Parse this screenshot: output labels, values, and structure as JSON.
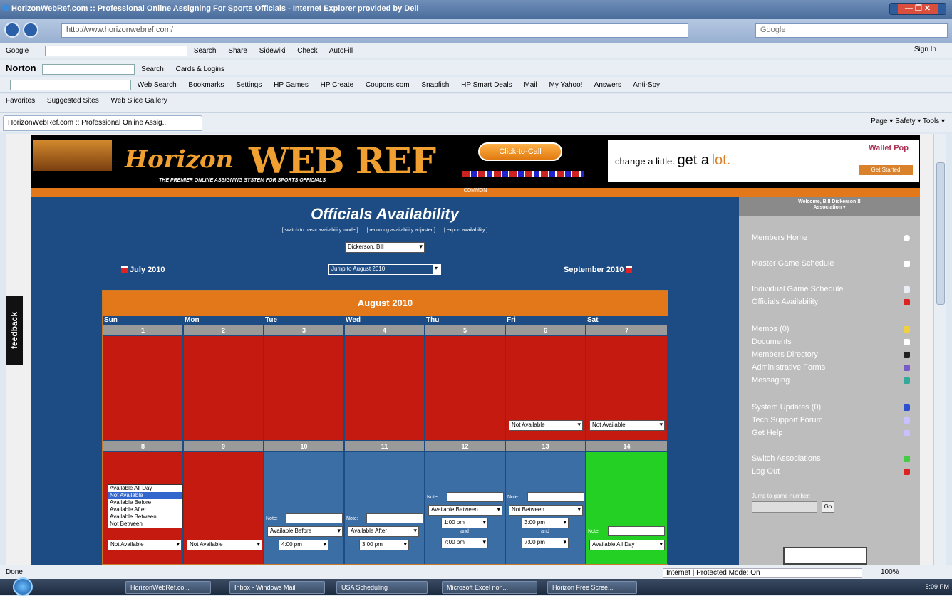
{
  "window": {
    "title": "HorizonWebRef.com :: Professional Online Assigning For Sports Officials - Internet Explorer provided by Dell",
    "controls": "— ❐ ✕"
  },
  "nav": {
    "url": "http://www.horizonwebref.com/",
    "search_placeholder": "Google"
  },
  "toolbar_google": {
    "label": "Google",
    "items": [
      "Search",
      "Share",
      "Sidewiki",
      "Check",
      "AutoFill",
      "Sign In"
    ]
  },
  "toolbar_norton": {
    "label": "Norton",
    "search_btn": "Search",
    "cards": "Cards & Logins"
  },
  "toolbar_yahoo": {
    "items": [
      "Web Search",
      "Bookmarks",
      "Settings",
      "HP Games",
      "HP Create",
      "Coupons.com",
      "Snapfish",
      "HP Smart Deals",
      "Mail",
      "My Yahoo!",
      "Answers",
      "Anti-Spy"
    ]
  },
  "favbar": {
    "favorites": "Favorites",
    "suggested": "Suggested Sites",
    "slice": "Web Slice Gallery"
  },
  "tab": {
    "label": "HorizonWebRef.com :: Professional Online Assig...",
    "tools": "Page ▾  Safety ▾  Tools ▾"
  },
  "feedback": "feedback",
  "header": {
    "horizon": "Horizon",
    "webref": "WEB REF",
    "tagline": "THE PREMIER ONLINE ASSIGNING SYSTEM FOR SPORTS OFFICIALS",
    "call": "Click-to-Call",
    "ad_text1": "change a little.",
    "ad_text2": "get a",
    "ad_text3": "lot.",
    "ad_brand": "Wallet Pop",
    "ad_btn": "Get Started"
  },
  "stripe": "COMMON",
  "availability": {
    "title": "Officials Availability",
    "link1": "[ switch to basic availability mode ]",
    "link2": "[ recurring availability adjuster ]",
    "link3": "[ export availability ]",
    "official": "Dickerson, Bill",
    "prev_month": "July 2010",
    "jump": "Jump to August 2010",
    "next_month": "September 2010"
  },
  "calendar": {
    "month": "August 2010",
    "days": [
      "Sun",
      "Mon",
      "Tue",
      "Wed",
      "Thu",
      "Fri",
      "Sat"
    ],
    "week1": [
      "1",
      "2",
      "3",
      "4",
      "5",
      "6",
      "7"
    ],
    "week2": [
      "8",
      "9",
      "10",
      "11",
      "12",
      "13",
      "14"
    ],
    "note_label": "Note:",
    "and_label": "and",
    "cells": {
      "fri6": "Not Available",
      "sat7": "Not Available",
      "sun8": "Not Available",
      "mon9": "Not Available",
      "tue10": "Available Before",
      "tue10_time": "4:00 pm",
      "wed11": "Available After",
      "wed11_time": "3:00 pm",
      "thu12": "Available Between",
      "thu12_t1": "1:00 pm",
      "thu12_t2": "7:00 pm",
      "fri13": "Not Between",
      "fri13_t1": "3:00 pm",
      "fri13_t2": "7:00 pm",
      "sat14": "Available All Day"
    },
    "dropdown_options": [
      "Available All Day",
      "Not Available",
      "Available Before",
      "Available After",
      "Available Between",
      "Not Between"
    ],
    "dropdown_selected": "Not Available"
  },
  "sidebar": {
    "welcome": "Welcome, Bill Dickerson !!",
    "assoc": "Association ▾",
    "menu": {
      "home": "Members Home",
      "master": "Master Game Schedule",
      "individual": "Individual Game Schedule",
      "availability": "Officials Availability",
      "memos": "Memos (0)",
      "documents": "Documents",
      "directory": "Members Directory",
      "forms": "Administrative Forms",
      "messaging": "Messaging",
      "updates": "System Updates (0)",
      "forum": "Tech Support Forum",
      "help": "Get Help",
      "switch": "Switch Associations",
      "logout": "Log Out"
    },
    "jump_label": "Jump to game number:",
    "go": "Go"
  },
  "status": {
    "left": "Done",
    "zone": "Internet | Protected Mode: On",
    "zoom": "100%"
  },
  "taskbar": {
    "items": [
      "HorizonWebRef.co...",
      "Inbox - Windows Mail",
      "USA Scheduling",
      "Microsoft Excel non...",
      "Horizon Free Scree..."
    ],
    "clock": "5:09 PM"
  },
  "colors": {
    "navy": "#1d4c84",
    "orange": "#e3781b",
    "red": "#c41a10",
    "green": "#24d024",
    "blue": "#3c6ea6"
  }
}
